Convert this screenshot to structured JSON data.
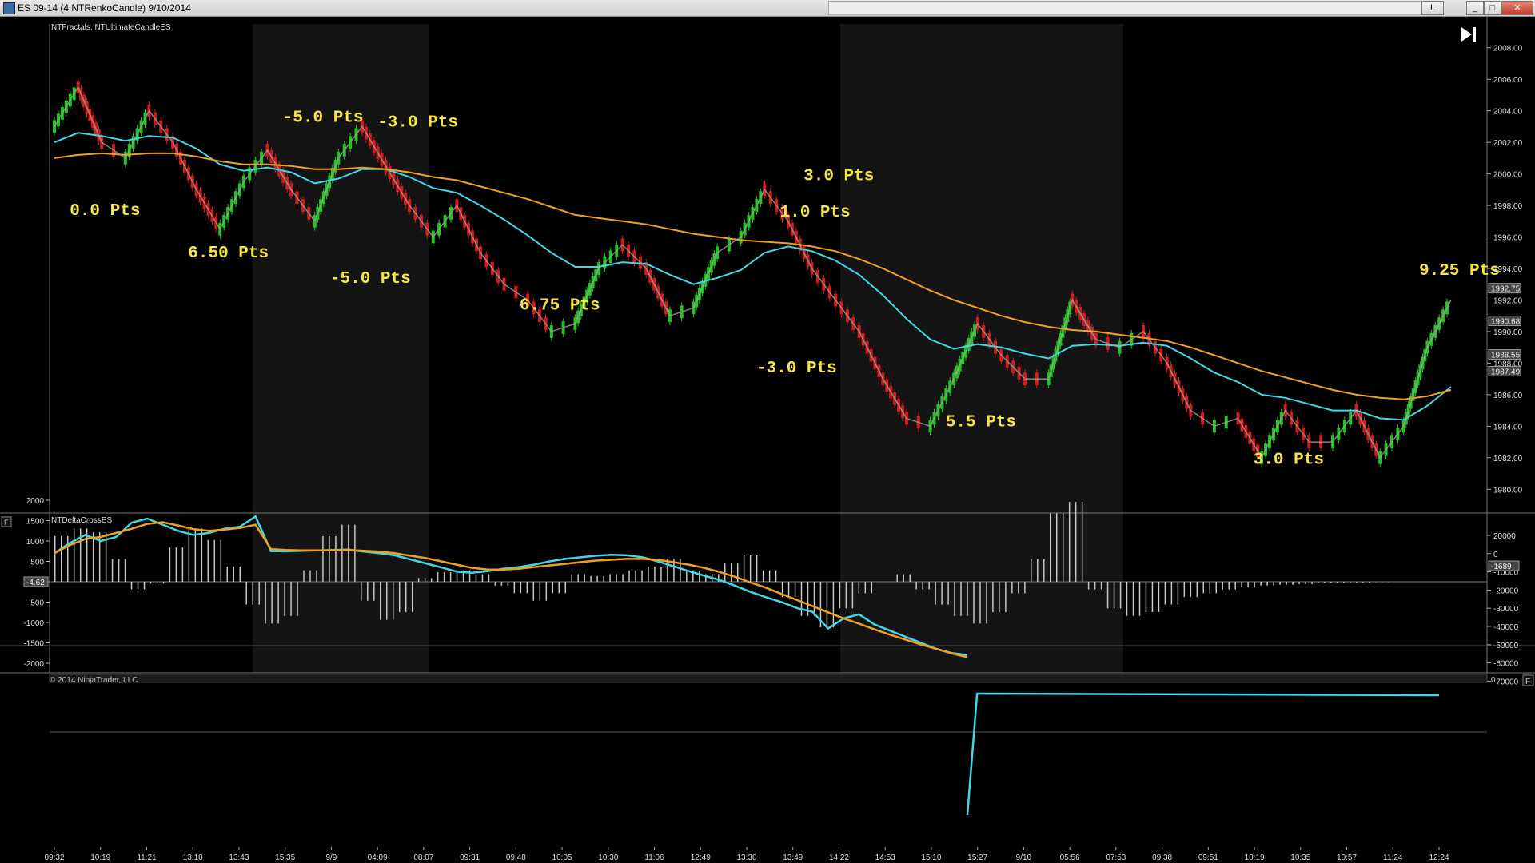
{
  "window": {
    "title": "ES 09-14 (4 NTRenkoCandle)  9/10/2014",
    "link_button": "L",
    "minimize": "_",
    "maximize": "□",
    "close": "✕"
  },
  "colors": {
    "background": "#000000",
    "up_bar": "#22c422",
    "down_bar": "#d21c1c",
    "ema_fast": "#40d8e8",
    "ema_slow": "#f0a020",
    "ema_mid": "#a0a0a0",
    "target_label": "#f5e642",
    "resistance": "#e01818",
    "support": "#28e028",
    "fractal": "#c020c0"
  },
  "chart_data": [
    {
      "type": "line",
      "title": "NTFractals, NTUltimateCandleES",
      "ylim": [
        1979,
        2009
      ],
      "y_ticks": [
        "2008.00",
        "2006.00",
        "2004.00",
        "2002.00",
        "2000.00",
        "1998.00",
        "1996.00",
        "1994.00",
        "1992.00",
        "1990.00",
        "1988.00",
        "1986.00",
        "1984.00",
        "1982.00",
        "1980.00"
      ],
      "x_ticks": [
        "09:32",
        "10:19",
        "11:21",
        "13:10",
        "13:43",
        "15:35",
        "9/9",
        "04:09",
        "08:07",
        "09:31",
        "09:48",
        "10:05",
        "10:30",
        "11:06",
        "12:49",
        "13:30",
        "13:49",
        "14:22",
        "14:53",
        "15:10",
        "15:27",
        "9/10",
        "05:56",
        "07:53",
        "09:38",
        "09:51",
        "10:19",
        "10:35",
        "10:57",
        "11:24",
        "12:24"
      ],
      "price_markers": [
        {
          "label": "1992.75",
          "value": 1992.75
        },
        {
          "label": "1990.68",
          "value": 1990.68
        },
        {
          "label": "1988.55",
          "value": 1988.55
        },
        {
          "label": "1987.49",
          "value": 1987.49
        }
      ],
      "series": [
        {
          "values": [
            2003.0,
            2005.5,
            2002.0,
            2001.0,
            2004.0,
            2002.0,
            1999.0,
            1996.5,
            1999.5,
            2001.5,
            1999.0,
            1997.0,
            2001.0,
            2003.0,
            2000.5,
            1998.0,
            1996.0,
            1998.0,
            1995.0,
            1993.0,
            1992.0,
            1990.0,
            1990.5,
            1994.0,
            1995.5,
            1994.0,
            1991.0,
            1991.5,
            1995.0,
            1996.0,
            1999.0,
            1997.0,
            1994.0,
            1992.0,
            1990.0,
            1987.0,
            1984.5,
            1984.0,
            1987.0,
            1990.5,
            1988.5,
            1987.0,
            1987.0,
            1992.0,
            1989.5,
            1989.0,
            1990.0,
            1988.0,
            1985.0,
            1984.0,
            1984.5,
            1982.0,
            1985.0,
            1983.0,
            1983.0,
            1985.0,
            1982.0,
            1984.0,
            1989.0,
            1992.0
          ]
        },
        {
          "values": [
            2002.0,
            2002.6,
            2002.4,
            2002.1,
            2002.4,
            2002.3,
            2001.6,
            2000.6,
            2000.2,
            2000.4,
            2000.1,
            1999.4,
            1999.7,
            2000.3,
            2000.3,
            1999.8,
            1999.1,
            1998.8,
            1998.0,
            1997.1,
            1996.1,
            1995.0,
            1994.1,
            1994.1,
            1994.4,
            1994.3,
            1993.6,
            1993.0,
            1993.4,
            1993.9,
            1995.0,
            1995.4,
            1995.1,
            1994.5,
            1993.6,
            1992.3,
            1990.8,
            1989.5,
            1988.9,
            1989.2,
            1989.0,
            1988.6,
            1988.3,
            1989.1,
            1989.2,
            1989.1,
            1989.3,
            1989.1,
            1988.3,
            1987.4,
            1986.8,
            1986.0,
            1985.8,
            1985.4,
            1985.0,
            1985.0,
            1984.5,
            1984.4,
            1985.3,
            1986.5
          ]
        },
        {
          "values": [
            2001.0,
            2001.2,
            2001.3,
            2001.2,
            2001.3,
            2001.3,
            2001.1,
            2000.8,
            2000.6,
            2000.6,
            2000.5,
            2000.3,
            2000.3,
            2000.4,
            2000.3,
            2000.1,
            1999.8,
            1999.6,
            1999.2,
            1998.8,
            1998.4,
            1997.9,
            1997.4,
            1997.2,
            1997.0,
            1996.8,
            1996.5,
            1996.2,
            1996.0,
            1995.8,
            1995.7,
            1995.6,
            1995.4,
            1995.1,
            1994.6,
            1994.0,
            1993.3,
            1992.6,
            1992.0,
            1991.5,
            1991.0,
            1990.6,
            1990.3,
            1990.1,
            1990.0,
            1989.8,
            1989.6,
            1989.4,
            1989.0,
            1988.5,
            1988.0,
            1987.5,
            1987.1,
            1986.7,
            1986.3,
            1986.0,
            1985.8,
            1985.7,
            1985.9,
            1986.3
          ]
        }
      ],
      "annotations": [
        {
          "text": "0.0 Pts",
          "x": 2,
          "y": 1997.4
        },
        {
          "text": "6.50 Pts",
          "x": 7,
          "y": 1994.7
        },
        {
          "text": "-5.0 Pts",
          "x": 11,
          "y": 2003.3
        },
        {
          "text": "-5.0 Pts",
          "x": 13,
          "y": 1993.1
        },
        {
          "text": "-3.0 Pts",
          "x": 15,
          "y": 2003.0
        },
        {
          "text": "6.75 Pts",
          "x": 21,
          "y": 1991.4
        },
        {
          "text": "-3.0 Pts",
          "x": 31,
          "y": 1987.4
        },
        {
          "text": "1.0 Pts",
          "x": 32,
          "y": 1997.3
        },
        {
          "text": "3.0 Pts",
          "x": 33,
          "y": 1999.6
        },
        {
          "text": "5.5 Pts",
          "x": 39,
          "y": 1984.0
        },
        {
          "text": "3.0 Pts",
          "x": 52,
          "y": 1981.6
        },
        {
          "text": "9.25 Pts",
          "x": 59,
          "y": 1993.6
        }
      ],
      "grid": false
    },
    {
      "type": "bar",
      "title": "NTDeltaCrossES",
      "left_ticks": [
        "2000",
        "1500",
        "1000",
        "500",
        "0",
        "-500",
        "-1000",
        "-1500",
        "-2000"
      ],
      "right_ticks": [
        "20000",
        "0",
        "-10000",
        "-20000",
        "-30000",
        "-40000",
        "-50000",
        "-60000",
        "-70000"
      ],
      "left_marker": "-4.62",
      "right_marker": "-1689",
      "values": [
        1200,
        1400,
        1300,
        600,
        -200,
        -50,
        900,
        1400,
        1100,
        400,
        -600,
        -1100,
        -900,
        300,
        1200,
        1500,
        -500,
        -1000,
        -800,
        100,
        250,
        300,
        200,
        -100,
        -300,
        -500,
        -300,
        200,
        150,
        200,
        300,
        400,
        600,
        300,
        200,
        500,
        700,
        300,
        -400,
        -900,
        -1200,
        -700,
        -300,
        0,
        200,
        -200,
        -600,
        -900,
        -1100,
        -800,
        -300,
        600,
        1800,
        2100,
        -200,
        -700,
        -900,
        -800,
        -600,
        -400,
        -300,
        -200,
        -150,
        -100,
        -80,
        -60,
        -40,
        -30,
        -20,
        -10
      ],
      "series": [
        {
          "values": [
            700,
            950,
            1150,
            1000,
            1100,
            1450,
            1550,
            1400,
            1250,
            1150,
            1200,
            1300,
            1350,
            1600,
            750,
            750,
            760,
            770,
            780,
            790,
            740,
            700,
            650,
            550,
            450,
            350,
            250,
            220,
            260,
            320,
            360,
            420,
            500,
            560,
            600,
            640,
            660,
            650,
            600,
            500,
            380,
            260,
            150,
            40,
            -100,
            -250,
            -380,
            -500,
            -650,
            -740,
            -1150,
            -900,
            -800,
            -1050,
            -1200,
            -1350,
            -1500,
            -1650,
            -1750,
            -1800
          ]
        },
        {
          "values": [
            700,
            900,
            1050,
            1100,
            1200,
            1300,
            1420,
            1460,
            1380,
            1290,
            1250,
            1280,
            1320,
            1400,
            800,
            780,
            770,
            770,
            770,
            780,
            760,
            740,
            700,
            640,
            580,
            500,
            420,
            340,
            300,
            300,
            320,
            360,
            400,
            440,
            480,
            520,
            540,
            560,
            560,
            540,
            480,
            420,
            340,
            240,
            120,
            -20,
            -150,
            -300,
            -450,
            -600,
            -750,
            -900,
            -1030,
            -1170,
            -1300,
            -1420,
            -1540,
            -1650,
            -1760,
            -1850
          ]
        }
      ]
    }
  ],
  "bottom_bar": {
    "copyright": "© 2014 NinjaTrader, LLC",
    "value": "0",
    "corner_icon": "F"
  },
  "scroll_end_icon": "skip-to-end-icon",
  "panel_icon": "panel-float-icon"
}
